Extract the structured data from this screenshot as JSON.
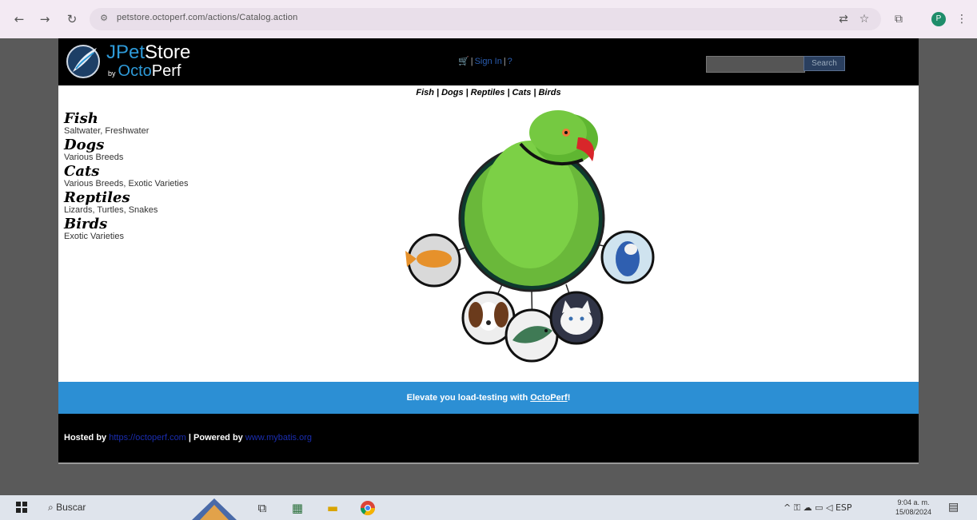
{
  "browser": {
    "url": "petstore.octoperf.com/actions/Catalog.action",
    "back_icon": "←",
    "forward_icon": "→",
    "reload_icon": "↻",
    "profile_initial": "P"
  },
  "header": {
    "logo_j": "J",
    "logo_pet": "Pet",
    "logo_store": "Store",
    "logo_by": "by",
    "logo_octo": "Octo",
    "logo_perf": "Perf",
    "cart_icon": "🛒",
    "sign_in": "Sign In",
    "help": "?",
    "search_placeholder": "",
    "search_button": "Search"
  },
  "quicklinks": [
    "Fish",
    "Dogs",
    "Reptiles",
    "Cats",
    "Birds"
  ],
  "sidebar": {
    "items": [
      {
        "title": "Fish",
        "desc": "Saltwater, Freshwater"
      },
      {
        "title": "Dogs",
        "desc": "Various Breeds"
      },
      {
        "title": "Cats",
        "desc": "Various Breeds, Exotic Varieties"
      },
      {
        "title": "Reptiles",
        "desc": "Lizards, Turtles, Snakes"
      },
      {
        "title": "Birds",
        "desc": "Exotic Varieties"
      }
    ]
  },
  "banner": {
    "text": "Elevate you load-testing with ",
    "link": "OctoPerf",
    "suffix": "!"
  },
  "footer": {
    "hosted_by": "Hosted by",
    "hosted_link": "https://octoperf.com",
    "powered_by": "| Powered by",
    "powered_link": "www.mybatis.org"
  },
  "taskbar": {
    "search_label": "Buscar",
    "lang": "ESP",
    "time": "9:04 a. m.",
    "date": "15/08/2024"
  },
  "colors": {
    "accent": "#2c8fd4",
    "header_bg": "#000000"
  }
}
